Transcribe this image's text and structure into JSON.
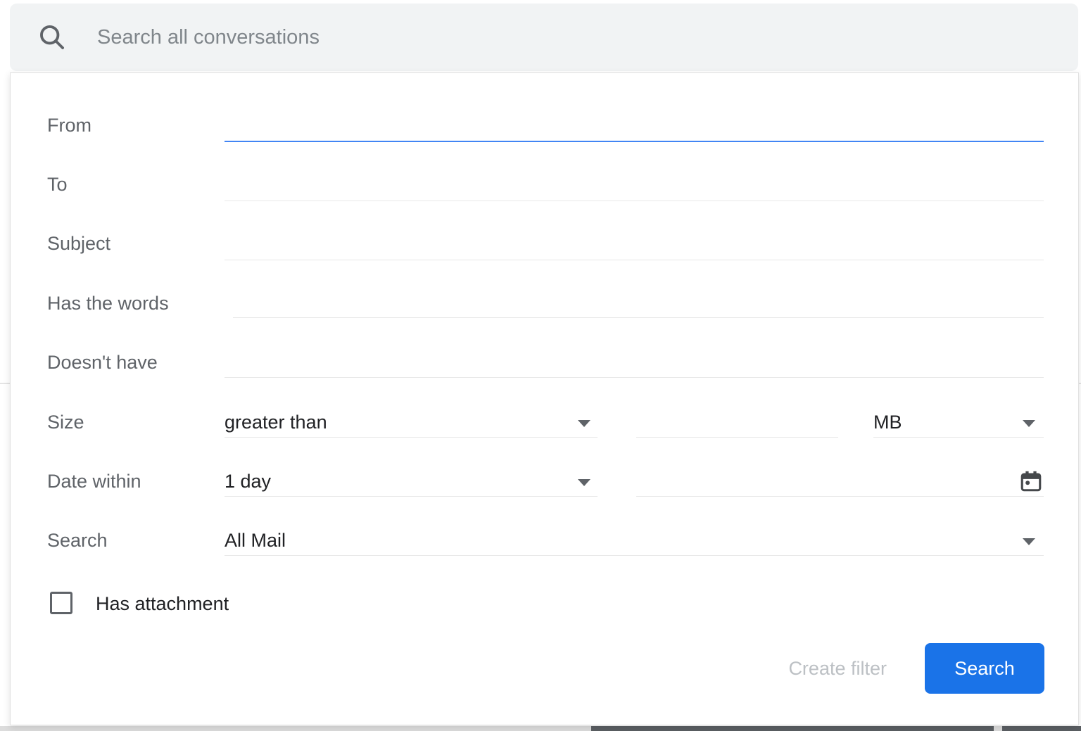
{
  "search_bar": {
    "placeholder": "Search all conversations",
    "icon": "magnifying-glass"
  },
  "filter_panel": {
    "fields": [
      {
        "label": "From",
        "value": "",
        "focused": true
      },
      {
        "label": "To",
        "value": "",
        "focused": false
      },
      {
        "label": "Subject",
        "value": "",
        "focused": false
      },
      {
        "label": "Has the words",
        "value": "",
        "focused": false
      },
      {
        "label": "Doesn't have",
        "value": "",
        "focused": false
      }
    ],
    "size_row": {
      "label": "Size",
      "comparator": "greater than",
      "amount": "",
      "unit": "MB"
    },
    "date_row": {
      "label": "Date within",
      "range": "1 day",
      "date": "",
      "icon": "calendar"
    },
    "scope_row": {
      "label": "Search",
      "value": "All Mail"
    },
    "has_attachment": {
      "label": "Has attachment",
      "checked": false
    },
    "actions": {
      "create_filter": "Create filter",
      "search": "Search"
    }
  },
  "icons": {
    "search": "magnifying-glass",
    "dropdown": "triangle-down",
    "calendar": "calendar-with-dot",
    "checkbox": "empty-checkbox"
  },
  "colors": {
    "accent_blue": "#1a73e8",
    "focus_underline": "#4285f4",
    "bar_background": "#f1f3f4",
    "label_gray": "#5f6368",
    "text_black": "#202124",
    "disabled_button": "#bcc0c4"
  }
}
